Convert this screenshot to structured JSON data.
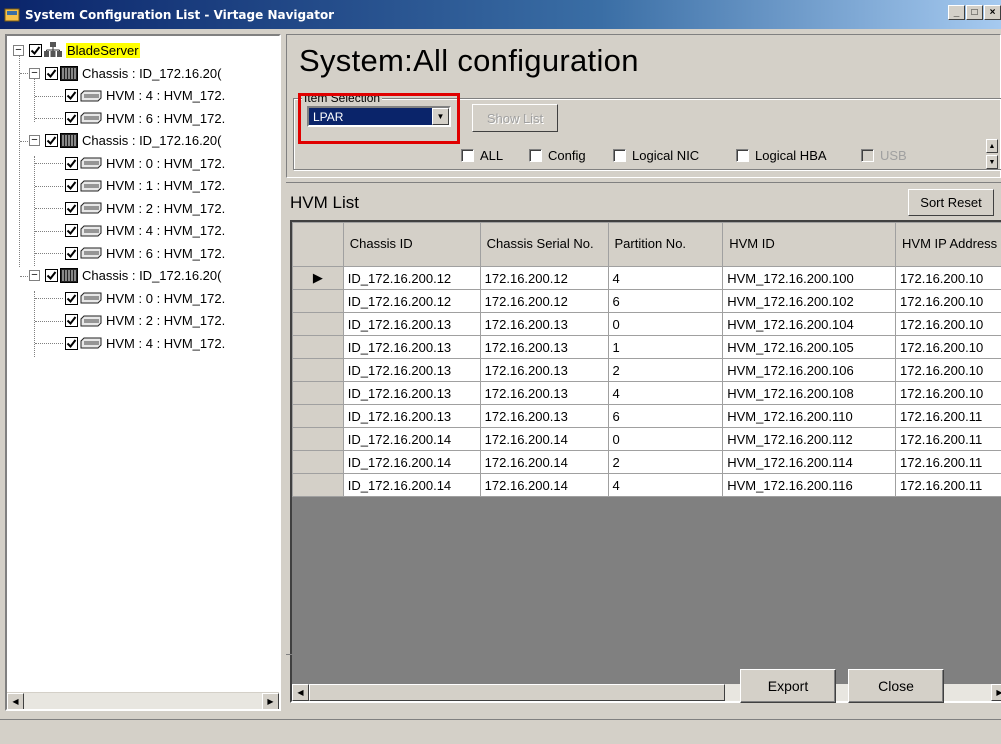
{
  "window": {
    "title": "System Configuration List - Virtage Navigator",
    "min": "_",
    "max": "□",
    "close": "×"
  },
  "tree": {
    "root": "BladeServer",
    "nodes": [
      {
        "label": "Chassis : ID_172.16.20(",
        "type": "chassis"
      },
      {
        "label": "HVM : 4 : HVM_172.",
        "type": "hvm"
      },
      {
        "label": "HVM : 6 : HVM_172.",
        "type": "hvm"
      },
      {
        "label": "Chassis : ID_172.16.20(",
        "type": "chassis"
      },
      {
        "label": "HVM : 0 : HVM_172.",
        "type": "hvm"
      },
      {
        "label": "HVM : 1 : HVM_172.",
        "type": "hvm"
      },
      {
        "label": "HVM : 2 : HVM_172.",
        "type": "hvm"
      },
      {
        "label": "HVM : 4 : HVM_172.",
        "type": "hvm"
      },
      {
        "label": "HVM : 6 : HVM_172.",
        "type": "hvm"
      },
      {
        "label": "Chassis : ID_172.16.20(",
        "type": "chassis"
      },
      {
        "label": "HVM : 0 : HVM_172.",
        "type": "hvm"
      },
      {
        "label": "HVM : 2 : HVM_172.",
        "type": "hvm"
      },
      {
        "label": "HVM : 4 : HVM_172.",
        "type": "hvm"
      }
    ],
    "expand_symbol": "−"
  },
  "main": {
    "title": "System:All configuration",
    "item_selection_legend": "Item Selection",
    "selected_item": "LPAR",
    "show_list_label": "Show List",
    "checkboxes": [
      {
        "label": "ALL",
        "checked": false,
        "enabled": true
      },
      {
        "label": "Config",
        "checked": false,
        "enabled": true
      },
      {
        "label": "Logical NIC",
        "checked": false,
        "enabled": true
      },
      {
        "label": "Logical HBA",
        "checked": false,
        "enabled": true
      },
      {
        "label": "USB",
        "checked": false,
        "enabled": false
      }
    ]
  },
  "list": {
    "title": "HVM List",
    "sort_reset_label": "Sort Reset",
    "columns": [
      "Chassis ID",
      "Chassis Serial No.",
      "Partition No.",
      "HVM ID",
      "HVM IP Address"
    ],
    "selected_row_marker": "▶",
    "rows": [
      [
        "ID_172.16.200.12",
        "172.16.200.12",
        "4",
        "HVM_172.16.200.100",
        "172.16.200.10"
      ],
      [
        "ID_172.16.200.12",
        "172.16.200.12",
        "6",
        "HVM_172.16.200.102",
        "172.16.200.10"
      ],
      [
        "ID_172.16.200.13",
        "172.16.200.13",
        "0",
        "HVM_172.16.200.104",
        "172.16.200.10"
      ],
      [
        "ID_172.16.200.13",
        "172.16.200.13",
        "1",
        "HVM_172.16.200.105",
        "172.16.200.10"
      ],
      [
        "ID_172.16.200.13",
        "172.16.200.13",
        "2",
        "HVM_172.16.200.106",
        "172.16.200.10"
      ],
      [
        "ID_172.16.200.13",
        "172.16.200.13",
        "4",
        "HVM_172.16.200.108",
        "172.16.200.10"
      ],
      [
        "ID_172.16.200.13",
        "172.16.200.13",
        "6",
        "HVM_172.16.200.110",
        "172.16.200.11"
      ],
      [
        "ID_172.16.200.14",
        "172.16.200.14",
        "0",
        "HVM_172.16.200.112",
        "172.16.200.11"
      ],
      [
        "ID_172.16.200.14",
        "172.16.200.14",
        "2",
        "HVM_172.16.200.114",
        "172.16.200.11"
      ],
      [
        "ID_172.16.200.14",
        "172.16.200.14",
        "4",
        "HVM_172.16.200.116",
        "172.16.200.11"
      ]
    ]
  },
  "footer": {
    "export_label": "Export",
    "close_label": "Close"
  },
  "colors": {
    "titlebar": "#0a246a",
    "selection": "#0a246a",
    "highlight": "#ffff00",
    "annotation": "#e00000",
    "face": "#d4d0c8"
  }
}
